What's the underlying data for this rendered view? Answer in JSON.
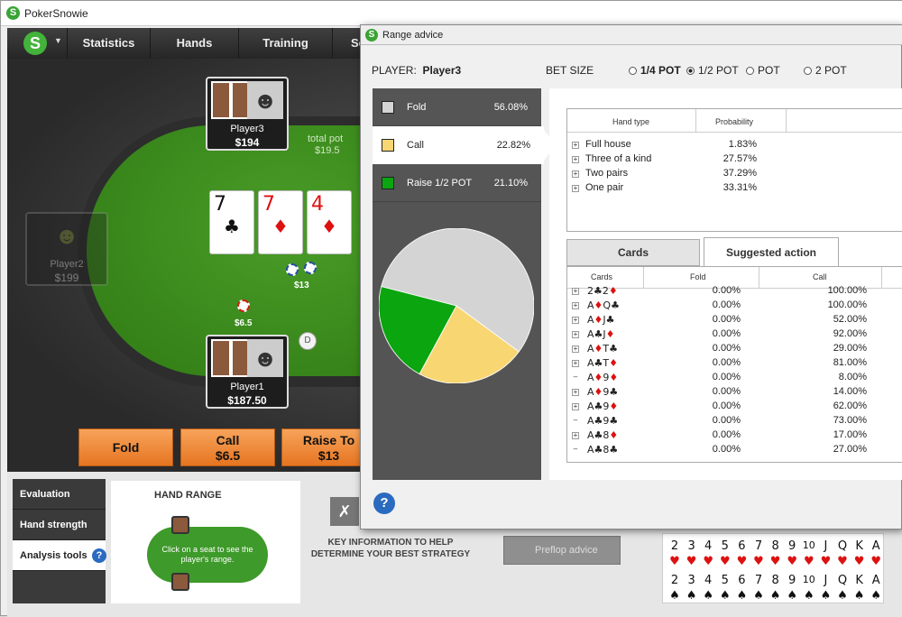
{
  "app": {
    "title": "PokerSnowie",
    "logo": "S"
  },
  "menu": {
    "items": [
      "Statistics",
      "Hands",
      "Training",
      "Se"
    ]
  },
  "table": {
    "players": [
      {
        "name": "Player3",
        "stack": "$194"
      },
      {
        "name": "Player2",
        "stack": "$199"
      },
      {
        "name": "Player1",
        "stack": "$187.50"
      }
    ],
    "pot_label": "total pot",
    "pot_value": "$19.5",
    "board": [
      {
        "rank": "7",
        "suit": "♣",
        "color": "#111111"
      },
      {
        "rank": "7",
        "suit": "♦",
        "color": "#dd1111"
      },
      {
        "rank": "4",
        "suit": "♦",
        "color": "#dd1111"
      }
    ],
    "bets": {
      "player3_bet": "$13",
      "player1_bet": "$6.5"
    },
    "dealer": "D"
  },
  "action_buttons": {
    "fold": "Fold",
    "call_label": "Call",
    "call_amount": "$6.5",
    "raise_label": "Raise To",
    "raise_amount": "$13"
  },
  "bottom": {
    "side_tabs": [
      "Evaluation",
      "Hand strength",
      "Analysis tools"
    ],
    "hand_range_title": "HAND RANGE",
    "range_hint": "Click on a seat to see the player's range.",
    "key_info": "KEY INFORMATION TO HELP DETERMINE YOUR BEST STRATEGY",
    "preflop_button": "Preflop advice",
    "grid_ranks": [
      "2",
      "3",
      "4",
      "5",
      "6",
      "7",
      "8",
      "9",
      "10",
      "J",
      "Q",
      "K",
      "A"
    ],
    "grid_suits": [
      "♥",
      "♠"
    ]
  },
  "dialog": {
    "title": "Range advice",
    "player_label": "PLAYER:",
    "player_name": "Player3",
    "bet_size_label": "BET SIZE",
    "bet_sizes": [
      {
        "label": "1/4 POT",
        "selected": false
      },
      {
        "label": "1/2 POT",
        "selected": true
      },
      {
        "label": "POT",
        "selected": false
      },
      {
        "label": "2 POT",
        "selected": false
      }
    ],
    "actions": [
      {
        "name": "Fold",
        "pct": "56.08%",
        "value": 56.08,
        "color": "#d4d4d4"
      },
      {
        "name": "Call",
        "pct": "22.82%",
        "value": 22.82,
        "color": "#f8d672"
      },
      {
        "name": "Raise 1/2 POT",
        "pct": "21.10%",
        "value": 21.1,
        "color": "#0aa50f"
      }
    ],
    "hand_type_headers": [
      "Hand type",
      "Probability"
    ],
    "hand_types": [
      {
        "type": "Full house",
        "prob": "1.83%"
      },
      {
        "type": "Three of a kind",
        "prob": "27.57%"
      },
      {
        "type": "Two pairs",
        "prob": "37.29%"
      },
      {
        "type": "One pair",
        "prob": "33.31%"
      }
    ],
    "tabs": [
      "Cards",
      "Suggested action"
    ],
    "card_headers": [
      "Cards",
      "Fold",
      "Call"
    ],
    "card_rows": [
      {
        "cards": "2♣2♦",
        "fold": "0.00%",
        "call": "100.00%",
        "expand": true
      },
      {
        "cards": "A♦Q♣",
        "fold": "0.00%",
        "call": "100.00%",
        "expand": true
      },
      {
        "cards": "A♦J♣",
        "fold": "0.00%",
        "call": "52.00%",
        "expand": true
      },
      {
        "cards": "A♣J♦",
        "fold": "0.00%",
        "call": "92.00%",
        "expand": true
      },
      {
        "cards": "A♦T♣",
        "fold": "0.00%",
        "call": "29.00%",
        "expand": true
      },
      {
        "cards": "A♣T♦",
        "fold": "0.00%",
        "call": "81.00%",
        "expand": true
      },
      {
        "cards": "A♦9♦",
        "fold": "0.00%",
        "call": "8.00%",
        "expand": false
      },
      {
        "cards": "A♦9♣",
        "fold": "0.00%",
        "call": "14.00%",
        "expand": true
      },
      {
        "cards": "A♣9♦",
        "fold": "0.00%",
        "call": "62.00%",
        "expand": true
      },
      {
        "cards": "A♣9♣",
        "fold": "0.00%",
        "call": "73.00%",
        "expand": false
      },
      {
        "cards": "A♣8♦",
        "fold": "0.00%",
        "call": "17.00%",
        "expand": true
      },
      {
        "cards": "A♣8♣",
        "fold": "0.00%",
        "call": "27.00%",
        "expand": false
      }
    ],
    "help": "?"
  }
}
